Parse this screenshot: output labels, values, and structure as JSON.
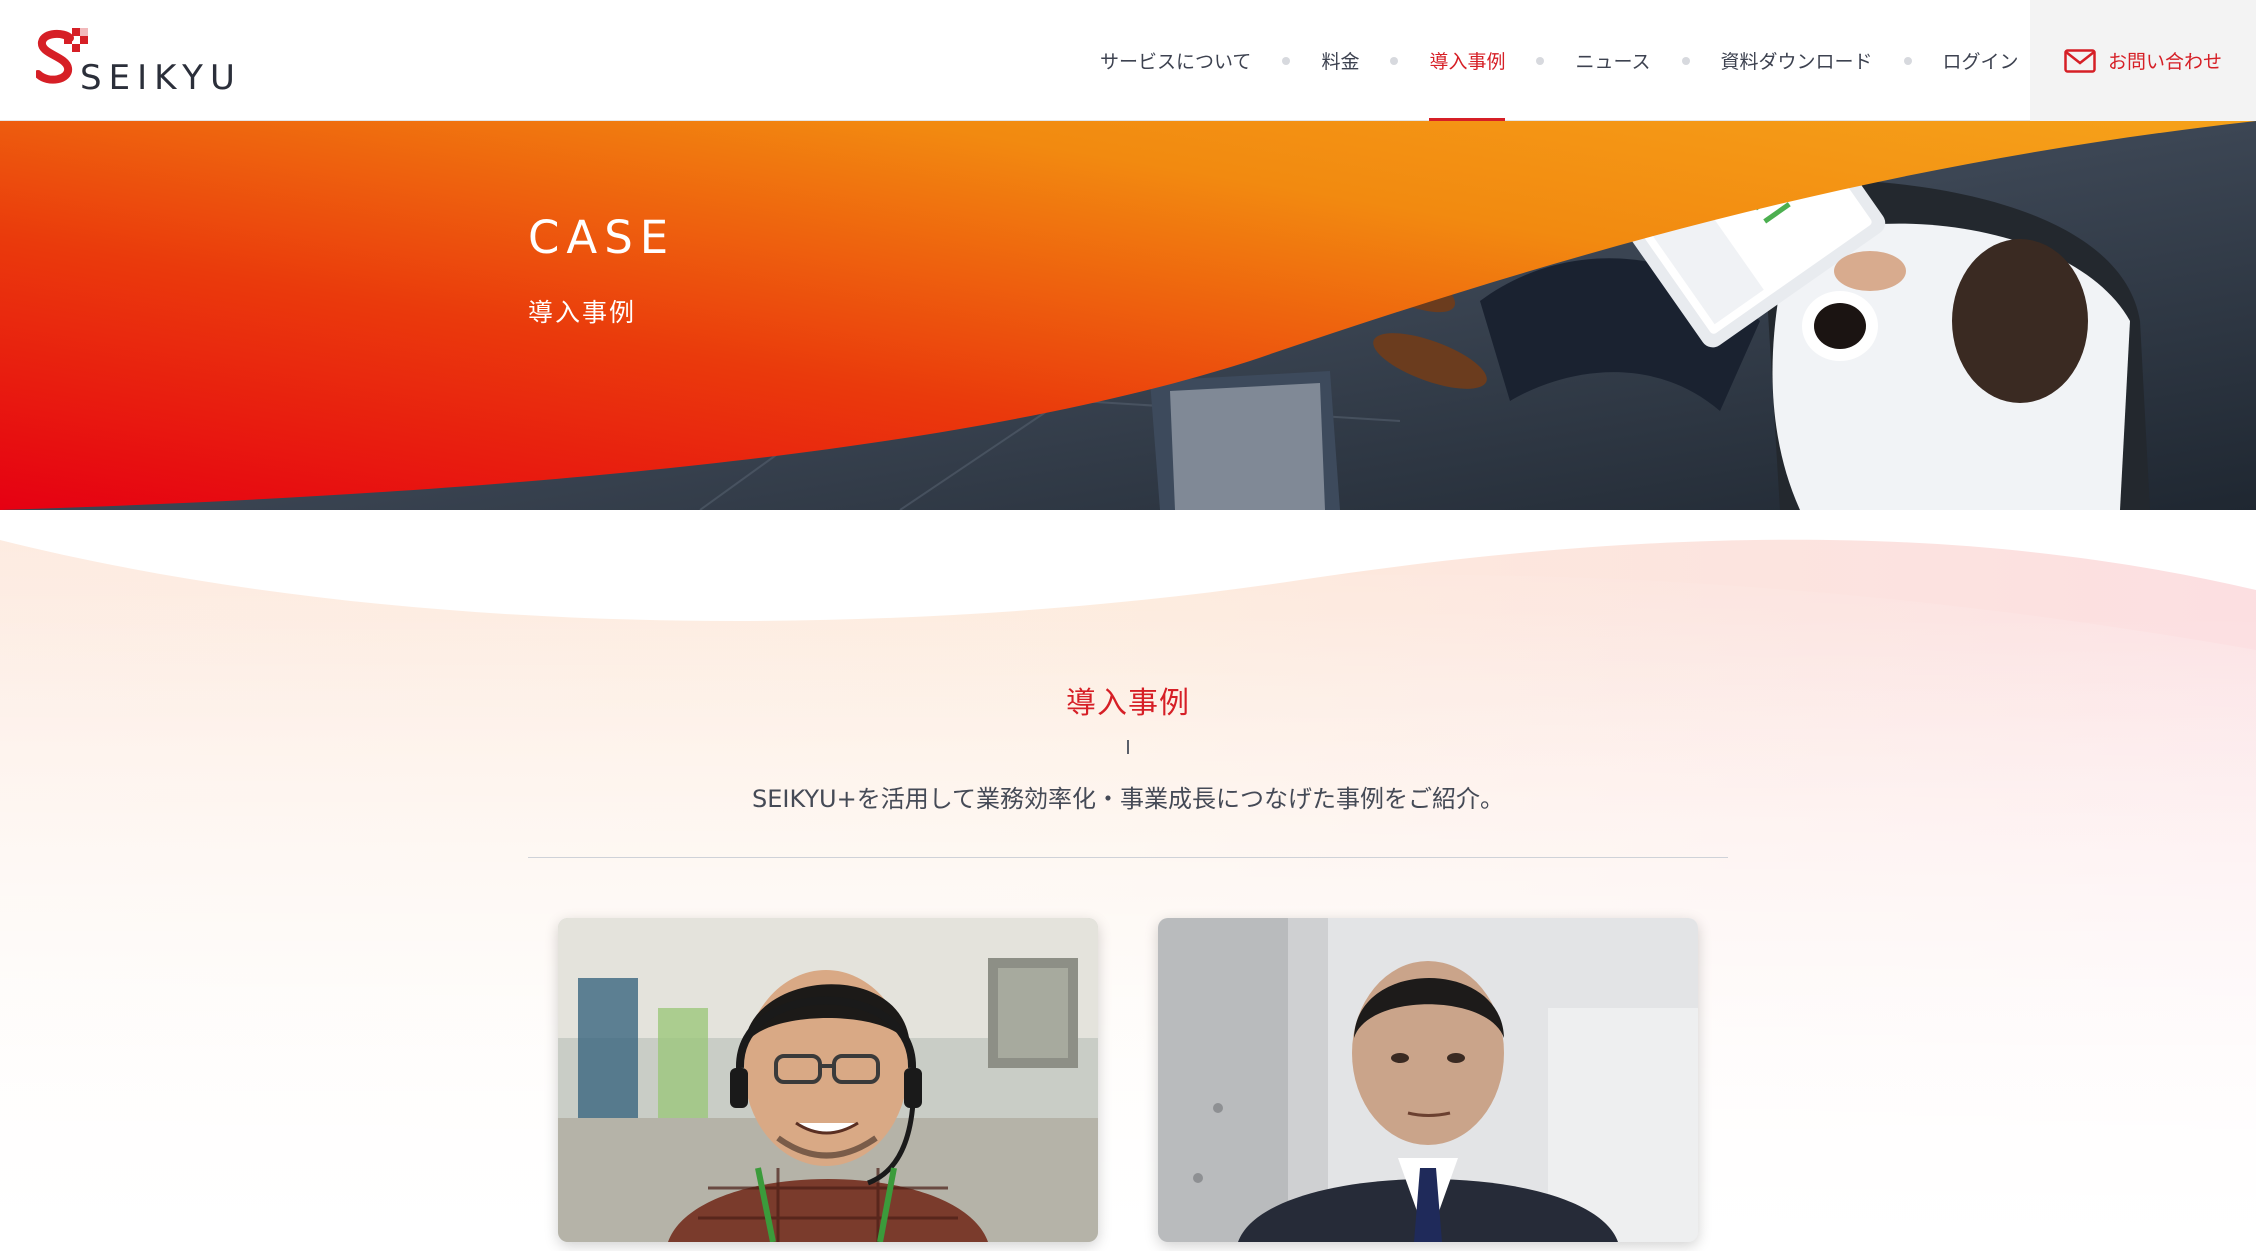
{
  "header": {
    "logo_text": "SEIKYU",
    "nav": [
      {
        "label": "サービスについて",
        "active": false
      },
      {
        "label": "料金",
        "active": false
      },
      {
        "label": "導入事例",
        "active": true
      },
      {
        "label": "ニュース",
        "active": false
      },
      {
        "label": "資料ダウンロード",
        "active": false
      },
      {
        "label": "ログイン",
        "active": false
      }
    ],
    "contact_label": "お問い合わせ",
    "contact_icon": "mail-icon"
  },
  "hero": {
    "title": "CASE",
    "subtitle": "導入事例"
  },
  "section": {
    "title": "導入事例",
    "description": "SEIKYU+を活用して業務効率化・事業成長につなげた事例をご紹介。"
  },
  "cases": [
    {
      "image": "case-photo-man-with-headset"
    },
    {
      "image": "case-photo-man-in-suit"
    }
  ],
  "colors": {
    "brand_red": "#d61f26",
    "hero_orange": "#f39c12",
    "hero_red": "#e60012"
  }
}
